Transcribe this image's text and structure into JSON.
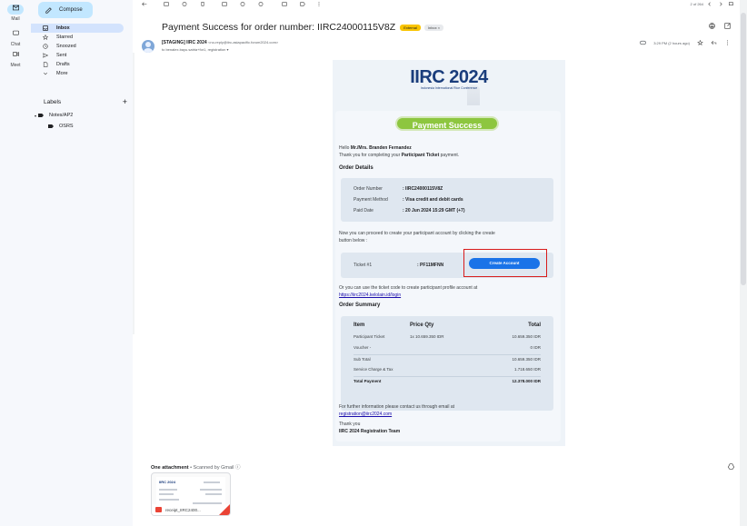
{
  "rail": {
    "mail": "Mail",
    "chat": "Chat",
    "meet": "Meet"
  },
  "sidebar": {
    "compose": "Compose",
    "items": [
      {
        "label": "Inbox",
        "icon": "inbox-icon"
      },
      {
        "label": "Starred",
        "icon": "star-icon"
      },
      {
        "label": "Snoozed",
        "icon": "clock-icon"
      },
      {
        "label": "Sent",
        "icon": "send-icon"
      },
      {
        "label": "Drafts",
        "icon": "draft-icon"
      },
      {
        "label": "More",
        "icon": "chevron-down-icon"
      }
    ],
    "labels_title": "Labels",
    "labels_add": "+",
    "labels": [
      "Notes/AP2",
      "OSRS"
    ]
  },
  "toolbar": {
    "pager": "2 of 264"
  },
  "email": {
    "subject": "Payment Success for order number: IIRC24000115V8Z",
    "badge_external": "External",
    "badge_inbox": "Inbox ×",
    "sender_name": "[STAGING] IIRC 2024",
    "sender_addr": "<no-reply@iirc-asiapacific.forum2024.com>",
    "recipients": "to benalex.bayu.satria+for1, registration ▾",
    "time": "3:29 PM (2 hours ago)"
  },
  "body": {
    "logo_text": "IIRC 2024",
    "logo_sub": "Indonesia International Rice Conference",
    "banner": "Payment Success",
    "greeting_prefix": "Hello ",
    "greeting_name": "Mr./Mrs. Branden Fernandez",
    "thanks_prefix": "Thank you for completing your ",
    "thanks_bold": "Participant Ticket",
    "thanks_suffix": " payment.",
    "order_details_title": "Order Details",
    "order_details": [
      {
        "key": "Order Number",
        "value": ": IIRC24000115V8Z"
      },
      {
        "key": "Payment Method",
        "value": ": Visa credit and debit cards"
      },
      {
        "key": "Paid Date",
        "value": ": 20 Jun 2024 15:29 GMT (+7)"
      }
    ],
    "proceed_line1": "Now you can proceed to create your participant account by clicking the create",
    "proceed_line2": "button below :",
    "ticket_label": "Ticket #1",
    "ticket_code": ": PF11MFNN",
    "create_button": "Create Account",
    "alt_line1": "Or you can use the ticket code to create participant profile account at",
    "alt_link": "https://iirc2024.kelolain.id/login",
    "order_summary_title": "Order Summary",
    "summary_headers": [
      "Item",
      "Price Qty",
      "Total"
    ],
    "summary_rows": [
      {
        "item": "Participant Ticket",
        "price": "1x 10.659.350 IDR",
        "total": "10.659.350 IDR"
      },
      {
        "item": "Voucher -",
        "price": "",
        "total": "0 IDR"
      },
      {
        "item": "Sub Total",
        "price": "",
        "total": "10.659.350 IDR"
      },
      {
        "item": "Service Charge & Tax",
        "price": "",
        "total": "1.718.650 IDR"
      },
      {
        "item": "Total Payment",
        "price": "",
        "total": "12.378.000 IDR"
      }
    ],
    "contact_line": "For further information please contact us through email at",
    "contact_email": "registration@iirc2024.com",
    "signoff1": "Thank you",
    "signoff2": "IIRC 2024 Registration Team"
  },
  "attachment": {
    "title": "One attachment",
    "scan": " • Scanned by Gmail ⓘ",
    "filename": "receipt_IIRC2400...",
    "preview_logo": "IIRC 2024"
  }
}
